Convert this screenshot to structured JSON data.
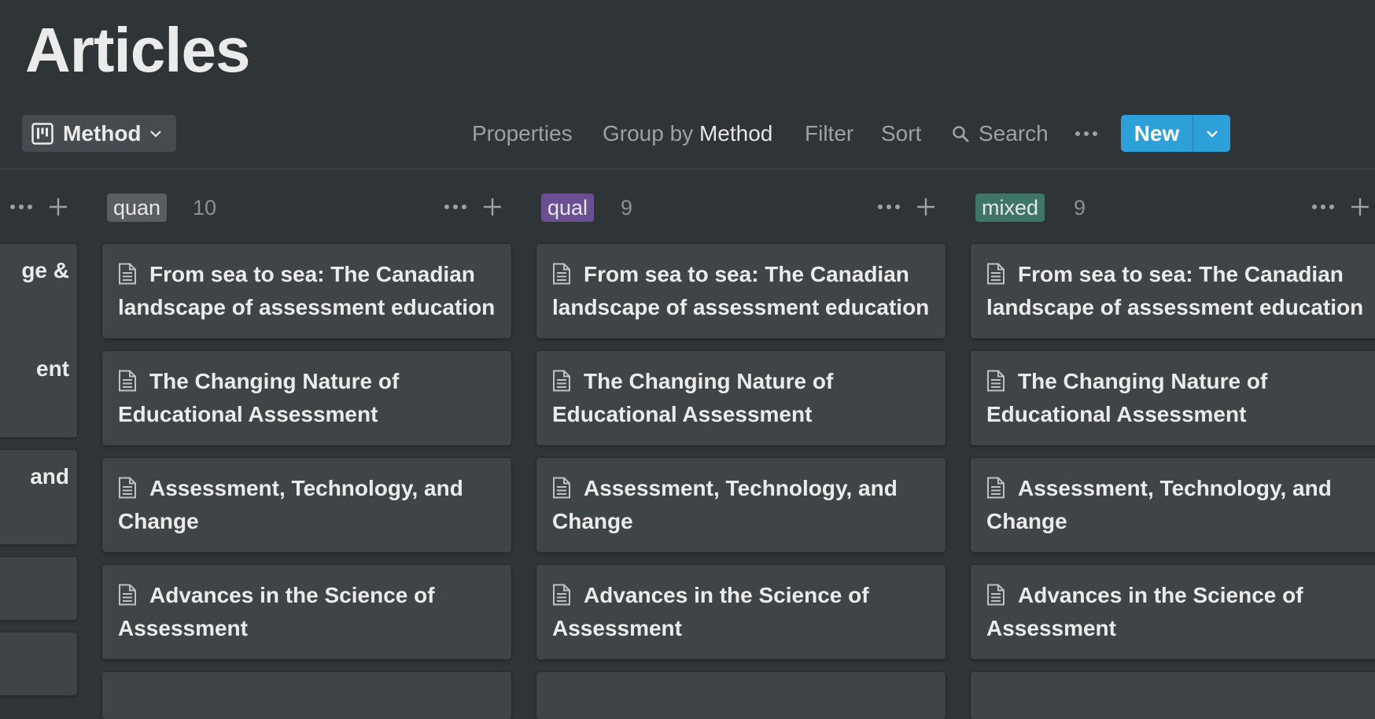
{
  "page": {
    "title": "Articles"
  },
  "view": {
    "name": "Method",
    "icon": "board-icon"
  },
  "toolbar": {
    "properties": "Properties",
    "group_by_prefix": "Group by",
    "group_by_value": "Method",
    "filter": "Filter",
    "sort": "Sort",
    "search": "Search",
    "new": "New"
  },
  "colors": {
    "background": "#2f3437",
    "card": "#3f4447",
    "accent": "#2ea0d9",
    "tag_quan": "#5a5e61",
    "tag_qual": "#6a4f93",
    "tag_mixed": "#3f7567"
  },
  "partial_column": {
    "cards": [
      "ge &",
      "ent",
      "and",
      "",
      ""
    ]
  },
  "columns": [
    {
      "tag": "quan",
      "count": "10",
      "cards": [
        {
          "title": "From sea to sea: The Canadian landscape of assessment education"
        },
        {
          "title": "The Changing Nature of Educational Assessment"
        },
        {
          "title": "Assessment, Technology, and Change"
        },
        {
          "title": "Advances in the Science of Assessment"
        }
      ]
    },
    {
      "tag": "qual",
      "count": "9",
      "cards": [
        {
          "title": "From sea to sea: The Canadian landscape of assessment education"
        },
        {
          "title": "The Changing Nature of Educational Assessment"
        },
        {
          "title": "Assessment, Technology, and Change"
        },
        {
          "title": "Advances in the Science of Assessment"
        }
      ]
    },
    {
      "tag": "mixed",
      "count": "9",
      "cards": [
        {
          "title": "From sea to sea: The Canadian landscape of assessment education"
        },
        {
          "title": "The Changing Nature of Educational Assessment"
        },
        {
          "title": "Assessment, Technology, and Change"
        },
        {
          "title": "Advances in the Science of Assessment"
        }
      ]
    }
  ]
}
